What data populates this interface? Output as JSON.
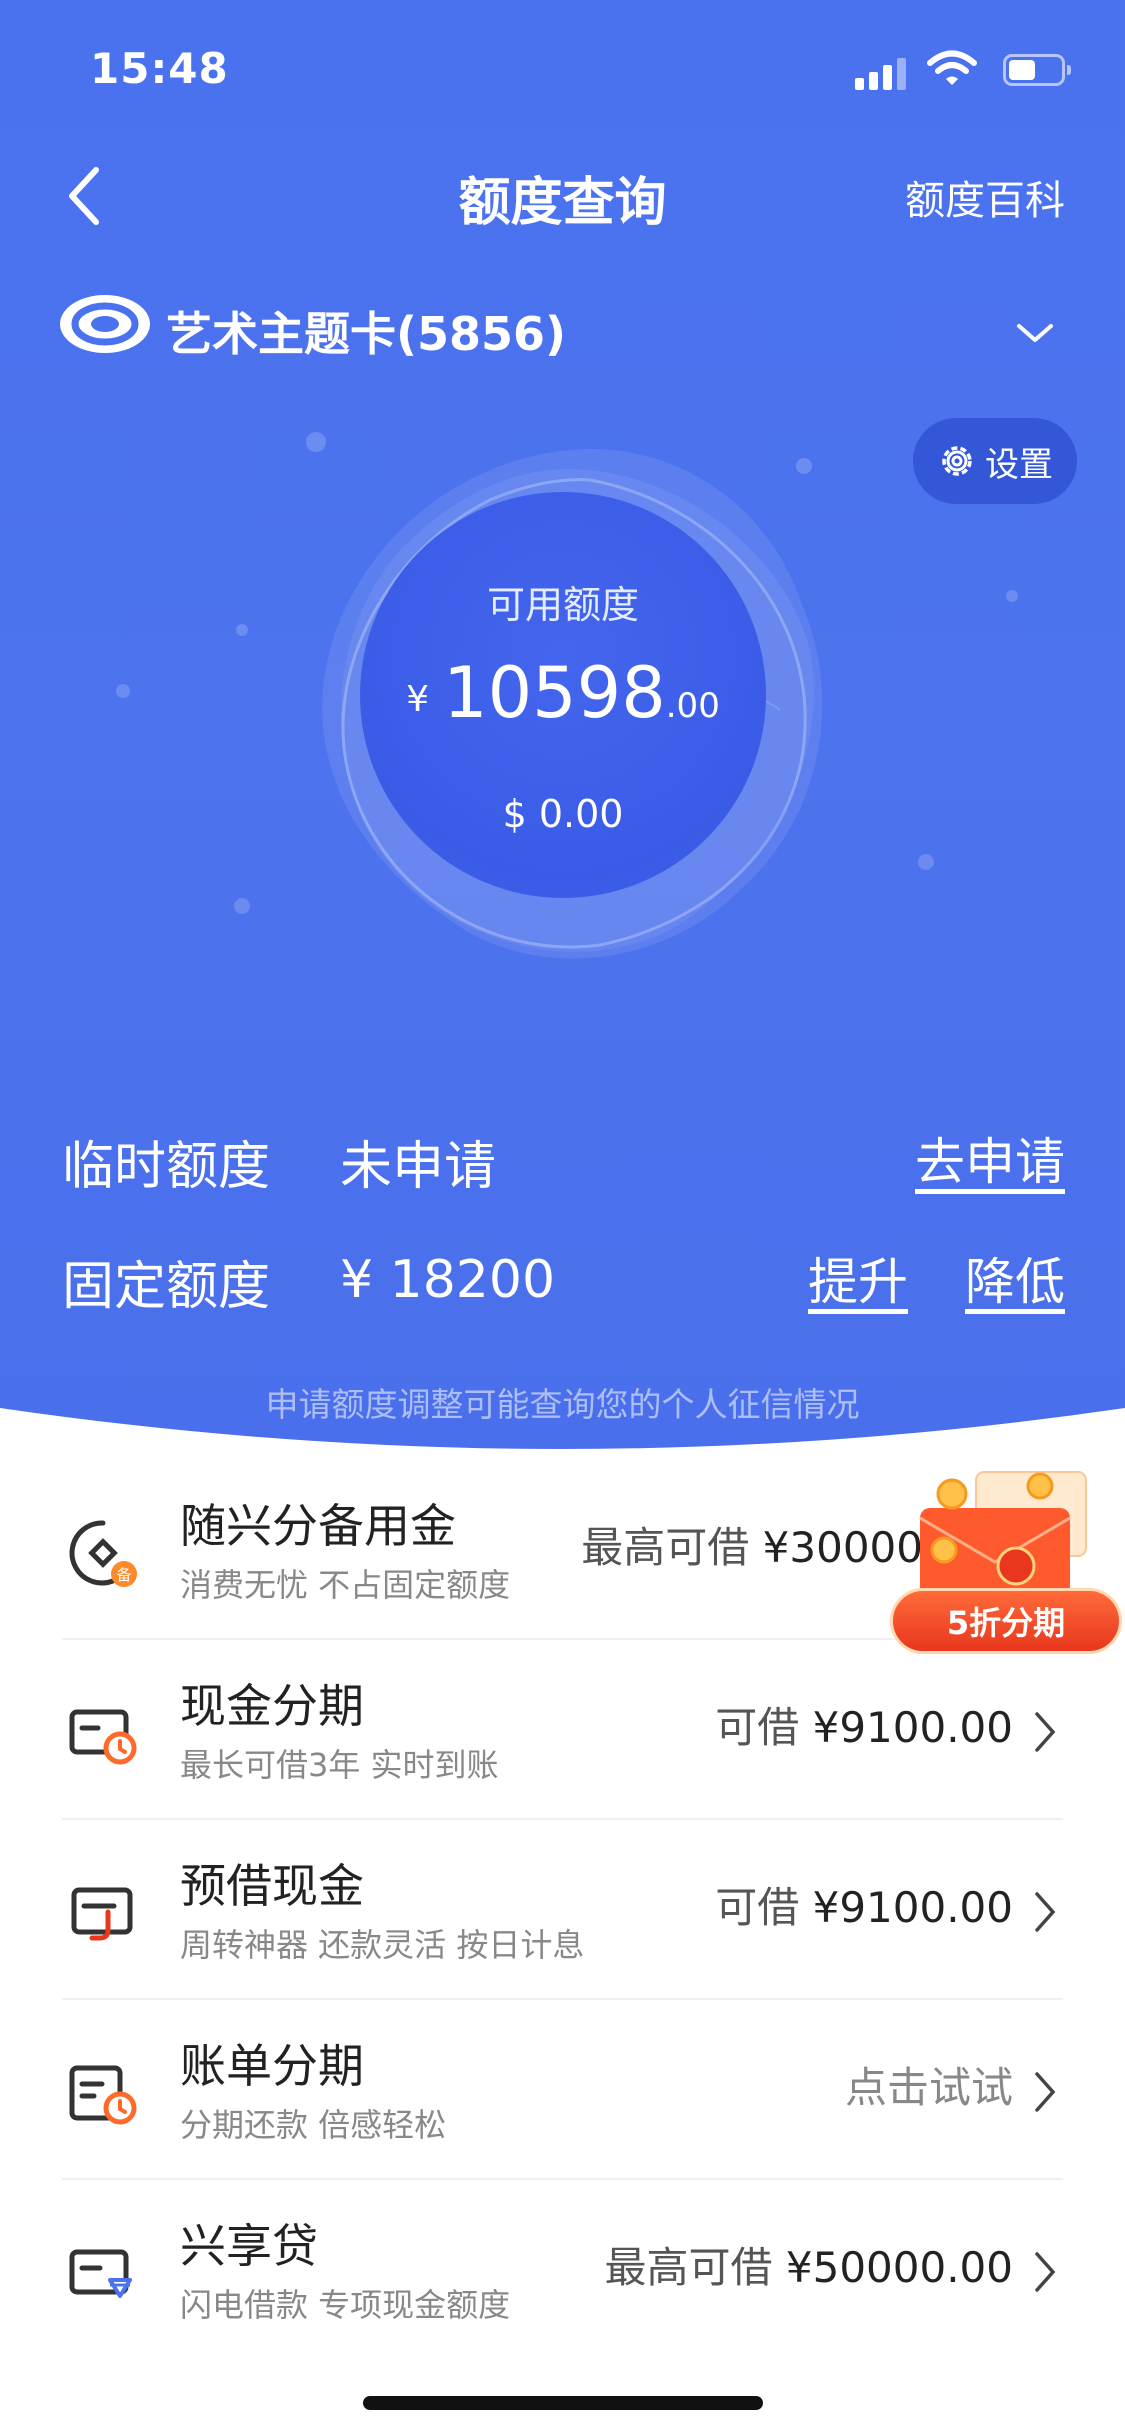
{
  "status": {
    "time": "15:48"
  },
  "nav": {
    "title": "额度查询",
    "right_link": "额度百科"
  },
  "card": {
    "name": "艺术主题卡(5856)"
  },
  "settings": {
    "label": "设置"
  },
  "credit": {
    "label": "可用额度",
    "currency": "¥",
    "amount_int": "10598",
    "amount_dec": ".00",
    "usd": "$ 0.00"
  },
  "temp_limit": {
    "label": "临时额度",
    "value": "未申请",
    "action": "去申请"
  },
  "fixed_limit": {
    "label": "固定额度",
    "value": "¥ 18200",
    "action_raise": "提升",
    "action_lower": "降低"
  },
  "notice": "申请额度调整可能查询您的个人征信情况",
  "promo": {
    "tag": "5折分期"
  },
  "services": [
    {
      "title": "随兴分备用金",
      "subtitle": "消费无忧 不占固定额度",
      "value_prefix": "最高可借 ",
      "value_amount": "¥30000",
      "icon": "reserve-fund-icon"
    },
    {
      "title": "现金分期",
      "subtitle": "最长可借3年 实时到账",
      "value_prefix": "可借 ",
      "value_amount": "¥9100.00",
      "icon": "cash-installment-icon"
    },
    {
      "title": "预借现金",
      "subtitle": "周转神器 还款灵活 按日计息",
      "value_prefix": "可借 ",
      "value_amount": "¥9100.00",
      "icon": "cash-advance-icon"
    },
    {
      "title": "账单分期",
      "subtitle": "分期还款 倍感轻松",
      "value_prefix": "点击试试",
      "value_amount": "",
      "icon": "bill-installment-icon"
    },
    {
      "title": "兴享贷",
      "subtitle": "闪电借款 专项现金额度",
      "value_prefix": "最高可借 ",
      "value_amount": "¥50000.00",
      "icon": "loan-icon"
    }
  ],
  "colors": {
    "primary": "#4a72ef",
    "icon_accent": "#ff6a2b"
  }
}
